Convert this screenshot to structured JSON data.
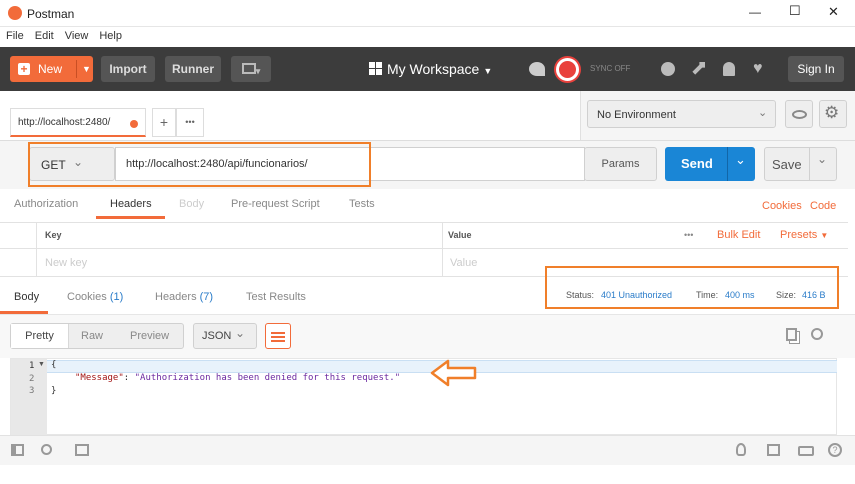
{
  "window": {
    "title": "Postman",
    "controls": {
      "minimize": "—",
      "maximize": "☐",
      "close": "✕"
    }
  },
  "menu": [
    "File",
    "Edit",
    "View",
    "Help"
  ],
  "toolbar": {
    "new_label": "New",
    "import_label": "Import",
    "runner_label": "Runner",
    "workspace_label": "My Workspace",
    "sync_label": "SYNC OFF",
    "signin_label": "Sign In"
  },
  "tabs": {
    "active_tab": "http://localhost:2480/",
    "add": "+",
    "more": "•••"
  },
  "environment": {
    "selected": "No Environment"
  },
  "request": {
    "method": "GET",
    "url": "http://localhost:2480/api/funcionarios/",
    "params_label": "Params",
    "send_label": "Send",
    "save_label": "Save"
  },
  "request_tabs": {
    "items": [
      "Authorization",
      "Headers",
      "Body",
      "Pre-request Script",
      "Tests"
    ],
    "cookies": "Cookies",
    "code": "Code"
  },
  "headers_table": {
    "key_header": "Key",
    "value_header": "Value",
    "more": "•••",
    "bulk_edit": "Bulk Edit",
    "presets": "Presets",
    "key_placeholder": "New key",
    "value_placeholder": "Value"
  },
  "response_tabs": {
    "body": "Body",
    "cookies": "Cookies",
    "cookies_count": "(1)",
    "headers": "Headers",
    "headers_count": "(7)",
    "tests": "Test Results"
  },
  "status": {
    "status_label": "Status:",
    "status_value": "401 Unauthorized",
    "time_label": "Time:",
    "time_value": "400 ms",
    "size_label": "Size:",
    "size_value": "416 B"
  },
  "viewer": {
    "pretty": "Pretty",
    "raw": "Raw",
    "preview": "Preview",
    "format": "JSON"
  },
  "code_lines": {
    "ln1": "1",
    "ln2": "2",
    "ln3": "3",
    "l1": "{",
    "key": "\"Message\"",
    "colon": ": ",
    "value": "\"Authorization has been denied for this request.\"",
    "l3": "}"
  },
  "colors": {
    "accent": "#f26b3a",
    "send_blue": "#1a86d6",
    "toolbar_bg": "#3c3c3c",
    "status_blue": "#2a7cc9",
    "json_key": "#a31515",
    "json_value": "#6c2aa0"
  }
}
